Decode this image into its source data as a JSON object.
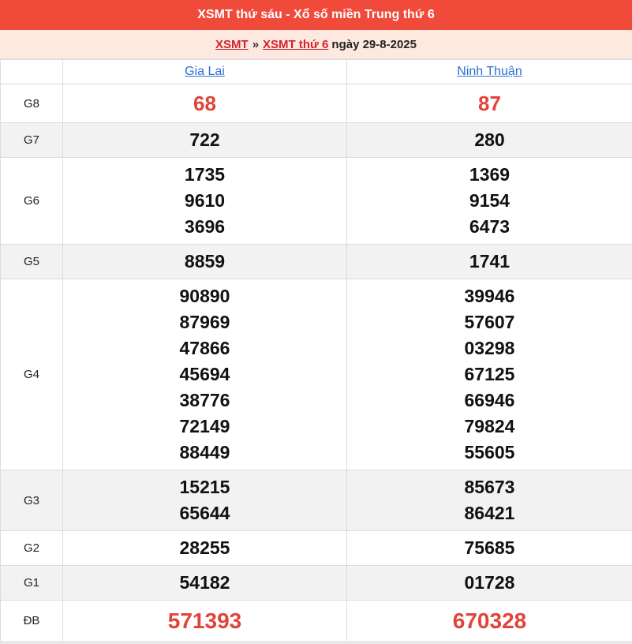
{
  "header": {
    "title": "XSMT thứ sáu - Xổ số miền Trung thứ 6"
  },
  "breadcrumb": {
    "link1": "XSMT",
    "separator": "»",
    "link2": "XSMT thứ 6",
    "date": "ngày 29-8-2025"
  },
  "provinces": [
    "Gia Lai",
    "Ninh Thuận"
  ],
  "colors": {
    "header_bg": "#f04a3b",
    "breadcrumb_bg": "#fde9df",
    "highlight_red": "#e0443a",
    "link_blue": "#2a6fd6"
  },
  "prizes": [
    {
      "label": "G8",
      "gia_lai": [
        "68"
      ],
      "ninh_thuan": [
        "87"
      ]
    },
    {
      "label": "G7",
      "gia_lai": [
        "722"
      ],
      "ninh_thuan": [
        "280"
      ]
    },
    {
      "label": "G6",
      "gia_lai": [
        "1735",
        "9610",
        "3696"
      ],
      "ninh_thuan": [
        "1369",
        "9154",
        "6473"
      ]
    },
    {
      "label": "G5",
      "gia_lai": [
        "8859"
      ],
      "ninh_thuan": [
        "1741"
      ]
    },
    {
      "label": "G4",
      "gia_lai": [
        "90890",
        "87969",
        "47866",
        "45694",
        "38776",
        "72149",
        "88449"
      ],
      "ninh_thuan": [
        "39946",
        "57607",
        "03298",
        "67125",
        "66946",
        "79824",
        "55605"
      ]
    },
    {
      "label": "G3",
      "gia_lai": [
        "15215",
        "65644"
      ],
      "ninh_thuan": [
        "85673",
        "86421"
      ]
    },
    {
      "label": "G2",
      "gia_lai": [
        "28255"
      ],
      "ninh_thuan": [
        "75685"
      ]
    },
    {
      "label": "G1",
      "gia_lai": [
        "54182"
      ],
      "ninh_thuan": [
        "01728"
      ]
    },
    {
      "label": "ĐB",
      "gia_lai": [
        "571393"
      ],
      "ninh_thuan": [
        "670328"
      ]
    }
  ]
}
